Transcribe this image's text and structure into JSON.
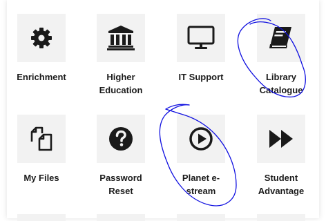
{
  "tiles": [
    {
      "label": "Enrichment",
      "icon": "gear-icon"
    },
    {
      "label": "Higher Education",
      "icon": "institution-icon"
    },
    {
      "label": "IT Support",
      "icon": "monitor-icon"
    },
    {
      "label": "Library Catalogue",
      "icon": "book-icon"
    },
    {
      "label": "My Files",
      "icon": "copy-files-icon"
    },
    {
      "label": "Password Reset",
      "icon": "question-circle-icon"
    },
    {
      "label": "Planet e-stream",
      "icon": "play-circle-icon"
    },
    {
      "label": "Student Advantage",
      "icon": "fast-forward-icon"
    }
  ],
  "colors": {
    "tile_bg": "#f2f2f2",
    "text": "#1b1b1b",
    "ink": "#1010e0"
  }
}
